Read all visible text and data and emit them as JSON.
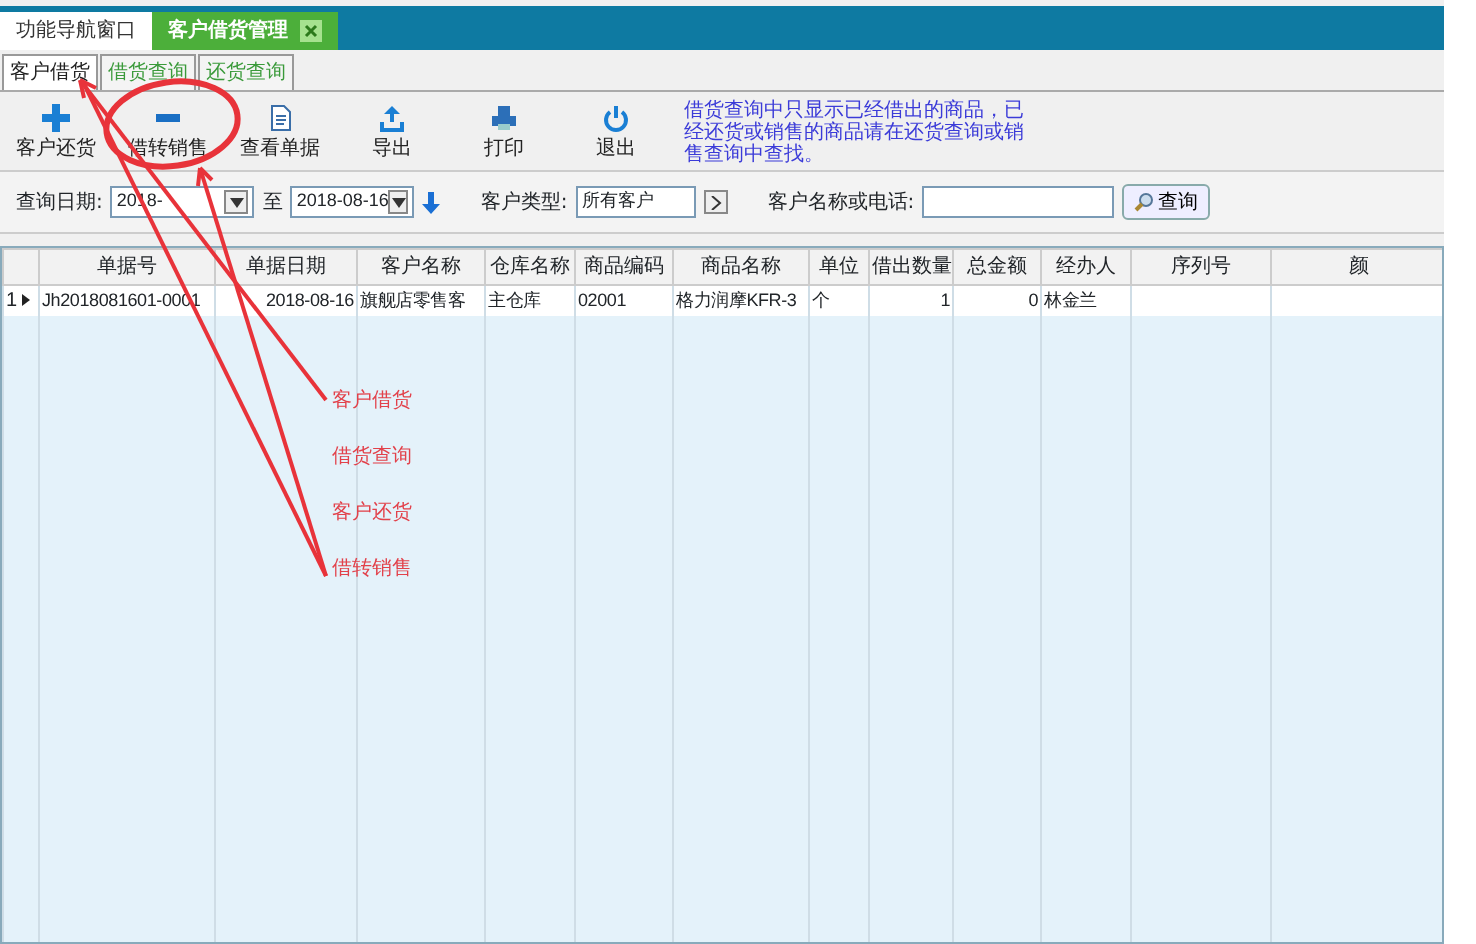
{
  "window_tabs": [
    {
      "label": "功能导航窗口",
      "selected": false,
      "closable": false
    },
    {
      "label": "客户借货管理",
      "selected": true,
      "closable": true
    }
  ],
  "sub_tabs": [
    {
      "label": "客户借货",
      "selected": true
    },
    {
      "label": "借货查询",
      "selected": false
    },
    {
      "label": "还货查询",
      "selected": false
    }
  ],
  "toolbar": [
    {
      "label": "客户还货"
    },
    {
      "label": "借转销售"
    },
    {
      "label": "查看单据"
    },
    {
      "label": "导出"
    },
    {
      "label": "打印"
    },
    {
      "label": "退出"
    }
  ],
  "notice": "借货查询中只显示已经借出的商品，已经还货或销售的商品请在还货查询或销售查询中查找。",
  "filter": {
    "date_label": "查询日期:",
    "date_from": "2018-",
    "to_label": "至",
    "date_to": "2018-08-16",
    "type_label": "客户类型:",
    "type_value": "所有客户",
    "name_label": "客户名称或电话:",
    "search_button": "查询"
  },
  "table": {
    "columns": [
      "单据号",
      "单据日期",
      "客户名称",
      "仓库名称",
      "商品编码",
      "商品名称",
      "单位",
      "借出数量",
      "总金额",
      "经办人",
      "序列号",
      "颜"
    ],
    "rows": [
      {
        "row_number": "1",
        "current": true,
        "cells": [
          "Jh2018081601-0001",
          "2018-08-16",
          "旗舰店零售客",
          "主仓库",
          "02001",
          "格力润摩KFR-3",
          "个",
          "1",
          "0",
          "林金兰",
          "",
          ""
        ]
      }
    ]
  },
  "annotations": [
    "客户借货",
    "借货查询",
    "客户还货",
    "借转销售"
  ]
}
